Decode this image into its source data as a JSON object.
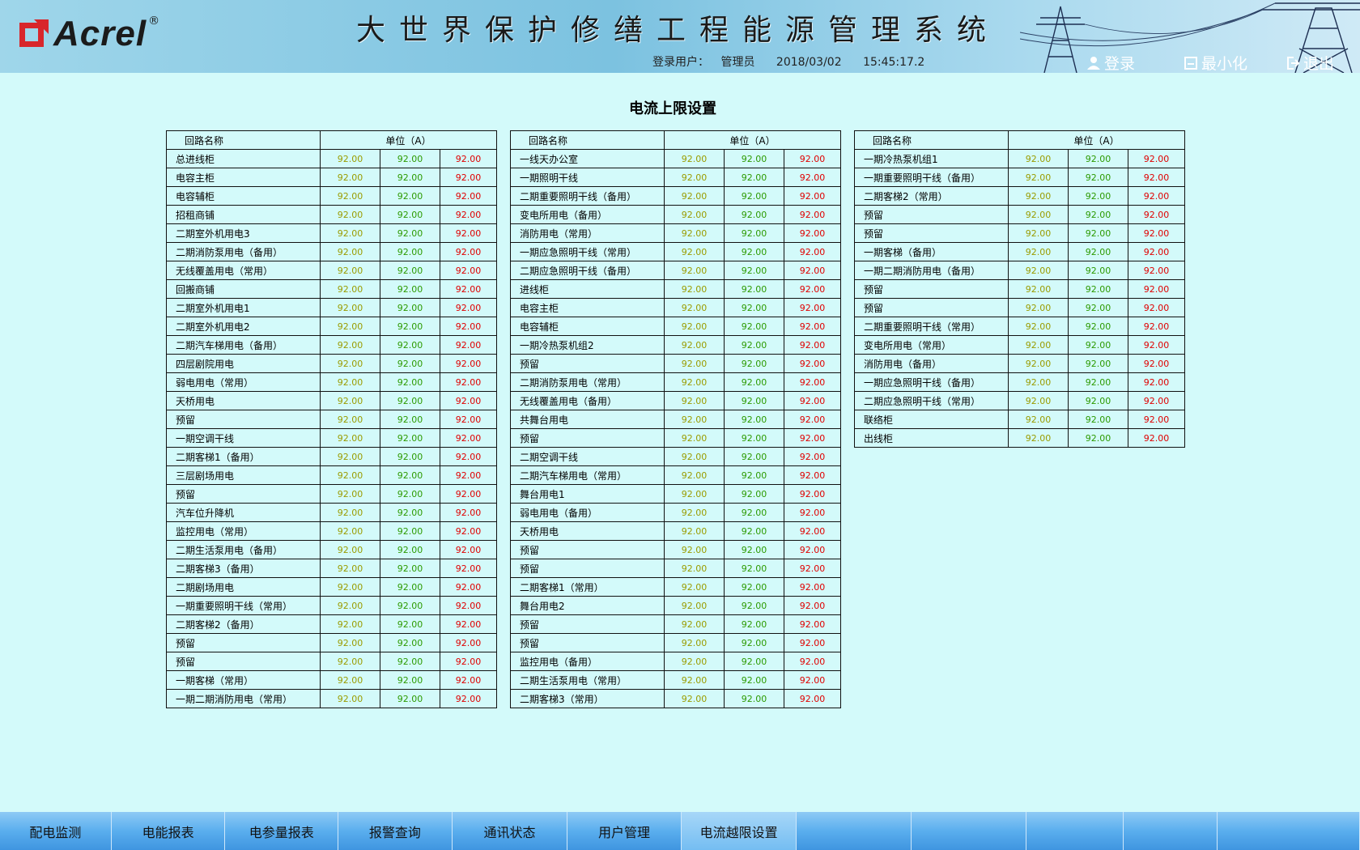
{
  "header": {
    "logo_text": "Acrel",
    "logo_reg": "®",
    "title": "大世界保护修缮工程能源管理系统",
    "user_label": "登录用户：",
    "user_name": "管理员",
    "date": "2018/03/02",
    "time": "15:45:17.2",
    "login_label": "登录",
    "minimize_label": "最小化",
    "exit_label": "退出"
  },
  "page": {
    "title": "电流上限设置"
  },
  "table_header": {
    "name_col": "回路名称",
    "unit_col": "单位（A）"
  },
  "value_colors": {
    "v1": "#9a9c00",
    "v2": "#2d9a00",
    "v3": "#e00000"
  },
  "tables": [
    {
      "rows": [
        {
          "name": "总进线柜",
          "v1": "92.00",
          "v2": "92.00",
          "v3": "92.00"
        },
        {
          "name": "电容主柜",
          "v1": "92.00",
          "v2": "92.00",
          "v3": "92.00"
        },
        {
          "name": "电容辅柜",
          "v1": "92.00",
          "v2": "92.00",
          "v3": "92.00"
        },
        {
          "name": "招租商铺",
          "v1": "92.00",
          "v2": "92.00",
          "v3": "92.00"
        },
        {
          "name": "二期室外机用电3",
          "v1": "92.00",
          "v2": "92.00",
          "v3": "92.00"
        },
        {
          "name": "二期消防泵用电（备用）",
          "v1": "92.00",
          "v2": "92.00",
          "v3": "92.00"
        },
        {
          "name": "无线覆盖用电（常用）",
          "v1": "92.00",
          "v2": "92.00",
          "v3": "92.00"
        },
        {
          "name": "回搬商铺",
          "v1": "92.00",
          "v2": "92.00",
          "v3": "92.00"
        },
        {
          "name": "二期室外机用电1",
          "v1": "92.00",
          "v2": "92.00",
          "v3": "92.00"
        },
        {
          "name": "二期室外机用电2",
          "v1": "92.00",
          "v2": "92.00",
          "v3": "92.00"
        },
        {
          "name": "二期汽车梯用电（备用）",
          "v1": "92.00",
          "v2": "92.00",
          "v3": "92.00"
        },
        {
          "name": "四层剧院用电",
          "v1": "92.00",
          "v2": "92.00",
          "v3": "92.00"
        },
        {
          "name": "弱电用电（常用）",
          "v1": "92.00",
          "v2": "92.00",
          "v3": "92.00"
        },
        {
          "name": "天桥用电",
          "v1": "92.00",
          "v2": "92.00",
          "v3": "92.00"
        },
        {
          "name": "预留",
          "v1": "92.00",
          "v2": "92.00",
          "v3": "92.00"
        },
        {
          "name": "一期空调干线",
          "v1": "92.00",
          "v2": "92.00",
          "v3": "92.00"
        },
        {
          "name": "二期客梯1（备用）",
          "v1": "92.00",
          "v2": "92.00",
          "v3": "92.00"
        },
        {
          "name": "三层剧场用电",
          "v1": "92.00",
          "v2": "92.00",
          "v3": "92.00"
        },
        {
          "name": "预留",
          "v1": "92.00",
          "v2": "92.00",
          "v3": "92.00"
        },
        {
          "name": "汽车位升降机",
          "v1": "92.00",
          "v2": "92.00",
          "v3": "92.00"
        },
        {
          "name": "监控用电（常用）",
          "v1": "92.00",
          "v2": "92.00",
          "v3": "92.00"
        },
        {
          "name": "二期生活泵用电（备用）",
          "v1": "92.00",
          "v2": "92.00",
          "v3": "92.00"
        },
        {
          "name": "二期客梯3（备用）",
          "v1": "92.00",
          "v2": "92.00",
          "v3": "92.00"
        },
        {
          "name": "二期剧场用电",
          "v1": "92.00",
          "v2": "92.00",
          "v3": "92.00"
        },
        {
          "name": "一期重要照明干线（常用）",
          "v1": "92.00",
          "v2": "92.00",
          "v3": "92.00"
        },
        {
          "name": "二期客梯2（备用）",
          "v1": "92.00",
          "v2": "92.00",
          "v3": "92.00"
        },
        {
          "name": "预留",
          "v1": "92.00",
          "v2": "92.00",
          "v3": "92.00"
        },
        {
          "name": "预留",
          "v1": "92.00",
          "v2": "92.00",
          "v3": "92.00"
        },
        {
          "name": "一期客梯（常用）",
          "v1": "92.00",
          "v2": "92.00",
          "v3": "92.00"
        },
        {
          "name": "一期二期消防用电（常用）",
          "v1": "92.00",
          "v2": "92.00",
          "v3": "92.00"
        }
      ]
    },
    {
      "rows": [
        {
          "name": "一线天办公室",
          "v1": "92.00",
          "v2": "92.00",
          "v3": "92.00"
        },
        {
          "name": "一期照明干线",
          "v1": "92.00",
          "v2": "92.00",
          "v3": "92.00"
        },
        {
          "name": "二期重要照明干线（备用）",
          "v1": "92.00",
          "v2": "92.00",
          "v3": "92.00"
        },
        {
          "name": "变电所用电（备用）",
          "v1": "92.00",
          "v2": "92.00",
          "v3": "92.00"
        },
        {
          "name": "消防用电（常用）",
          "v1": "92.00",
          "v2": "92.00",
          "v3": "92.00"
        },
        {
          "name": "一期应急照明干线（常用）",
          "v1": "92.00",
          "v2": "92.00",
          "v3": "92.00"
        },
        {
          "name": "二期应急照明干线（备用）",
          "v1": "92.00",
          "v2": "92.00",
          "v3": "92.00"
        },
        {
          "name": "进线柜",
          "v1": "92.00",
          "v2": "92.00",
          "v3": "92.00"
        },
        {
          "name": "电容主柜",
          "v1": "92.00",
          "v2": "92.00",
          "v3": "92.00"
        },
        {
          "name": "电容辅柜",
          "v1": "92.00",
          "v2": "92.00",
          "v3": "92.00"
        },
        {
          "name": "一期冷热泵机组2",
          "v1": "92.00",
          "v2": "92.00",
          "v3": "92.00"
        },
        {
          "name": "预留",
          "v1": "92.00",
          "v2": "92.00",
          "v3": "92.00"
        },
        {
          "name": "二期消防泵用电（常用）",
          "v1": "92.00",
          "v2": "92.00",
          "v3": "92.00"
        },
        {
          "name": "无线覆盖用电（备用）",
          "v1": "92.00",
          "v2": "92.00",
          "v3": "92.00"
        },
        {
          "name": "共舞台用电",
          "v1": "92.00",
          "v2": "92.00",
          "v3": "92.00"
        },
        {
          "name": "预留",
          "v1": "92.00",
          "v2": "92.00",
          "v3": "92.00"
        },
        {
          "name": "二期空调干线",
          "v1": "92.00",
          "v2": "92.00",
          "v3": "92.00"
        },
        {
          "name": "二期汽车梯用电（常用）",
          "v1": "92.00",
          "v2": "92.00",
          "v3": "92.00"
        },
        {
          "name": "舞台用电1",
          "v1": "92.00",
          "v2": "92.00",
          "v3": "92.00"
        },
        {
          "name": "弱电用电（备用）",
          "v1": "92.00",
          "v2": "92.00",
          "v3": "92.00"
        },
        {
          "name": "天桥用电",
          "v1": "92.00",
          "v2": "92.00",
          "v3": "92.00"
        },
        {
          "name": "预留",
          "v1": "92.00",
          "v2": "92.00",
          "v3": "92.00"
        },
        {
          "name": "预留",
          "v1": "92.00",
          "v2": "92.00",
          "v3": "92.00"
        },
        {
          "name": "二期客梯1（常用）",
          "v1": "92.00",
          "v2": "92.00",
          "v3": "92.00"
        },
        {
          "name": "舞台用电2",
          "v1": "92.00",
          "v2": "92.00",
          "v3": "92.00"
        },
        {
          "name": "预留",
          "v1": "92.00",
          "v2": "92.00",
          "v3": "92.00"
        },
        {
          "name": "预留",
          "v1": "92.00",
          "v2": "92.00",
          "v3": "92.00"
        },
        {
          "name": "监控用电（备用）",
          "v1": "92.00",
          "v2": "92.00",
          "v3": "92.00"
        },
        {
          "name": "二期生活泵用电（常用）",
          "v1": "92.00",
          "v2": "92.00",
          "v3": "92.00"
        },
        {
          "name": "二期客梯3（常用）",
          "v1": "92.00",
          "v2": "92.00",
          "v3": "92.00"
        }
      ]
    },
    {
      "rows": [
        {
          "name": "一期冷热泵机组1",
          "v1": "92.00",
          "v2": "92.00",
          "v3": "92.00"
        },
        {
          "name": "一期重要照明干线（备用）",
          "v1": "92.00",
          "v2": "92.00",
          "v3": "92.00"
        },
        {
          "name": "二期客梯2（常用）",
          "v1": "92.00",
          "v2": "92.00",
          "v3": "92.00"
        },
        {
          "name": "预留",
          "v1": "92.00",
          "v2": "92.00",
          "v3": "92.00"
        },
        {
          "name": "预留",
          "v1": "92.00",
          "v2": "92.00",
          "v3": "92.00"
        },
        {
          "name": "一期客梯（备用）",
          "v1": "92.00",
          "v2": "92.00",
          "v3": "92.00"
        },
        {
          "name": "一期二期消防用电（备用）",
          "v1": "92.00",
          "v2": "92.00",
          "v3": "92.00"
        },
        {
          "name": "预留",
          "v1": "92.00",
          "v2": "92.00",
          "v3": "92.00"
        },
        {
          "name": "预留",
          "v1": "92.00",
          "v2": "92.00",
          "v3": "92.00"
        },
        {
          "name": "二期重要照明干线（常用）",
          "v1": "92.00",
          "v2": "92.00",
          "v3": "92.00"
        },
        {
          "name": "变电所用电（常用）",
          "v1": "92.00",
          "v2": "92.00",
          "v3": "92.00"
        },
        {
          "name": "消防用电（备用）",
          "v1": "92.00",
          "v2": "92.00",
          "v3": "92.00"
        },
        {
          "name": "一期应急照明干线（备用）",
          "v1": "92.00",
          "v2": "92.00",
          "v3": "92.00"
        },
        {
          "name": "二期应急照明干线（常用）",
          "v1": "92.00",
          "v2": "92.00",
          "v3": "92.00"
        },
        {
          "name": "联络柜",
          "v1": "92.00",
          "v2": "92.00",
          "v3": "92.00"
        },
        {
          "name": "出线柜",
          "v1": "92.00",
          "v2": "92.00",
          "v3": "92.00"
        }
      ]
    }
  ],
  "nav": {
    "items": [
      {
        "label": "配电监测"
      },
      {
        "label": "电能报表"
      },
      {
        "label": "电参量报表"
      },
      {
        "label": "报警查询"
      },
      {
        "label": "通讯状态"
      },
      {
        "label": "用户管理"
      },
      {
        "label": "电流越限设置",
        "active": true
      },
      {
        "label": ""
      },
      {
        "label": ""
      },
      {
        "label": ""
      },
      {
        "label": ""
      },
      {
        "label": ""
      }
    ]
  }
}
